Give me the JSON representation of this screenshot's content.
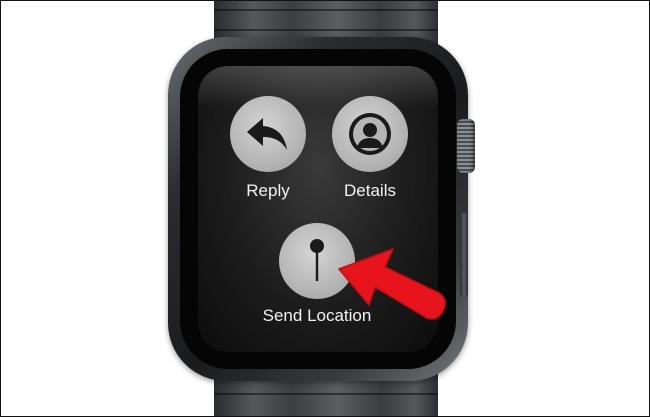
{
  "screen": {
    "actions": [
      {
        "id": "reply",
        "label": "Reply",
        "icon": "reply-arrow-icon"
      },
      {
        "id": "details",
        "label": "Details",
        "icon": "person-silhouette-icon"
      },
      {
        "id": "send_location",
        "label": "Send Location",
        "icon": "map-pin-icon"
      }
    ]
  },
  "colors": {
    "button_fill": "#b5b5b5",
    "icon_color": "#1a1a1a",
    "label_color": "#f2f2f2",
    "annotation_arrow": "#e8141b"
  }
}
